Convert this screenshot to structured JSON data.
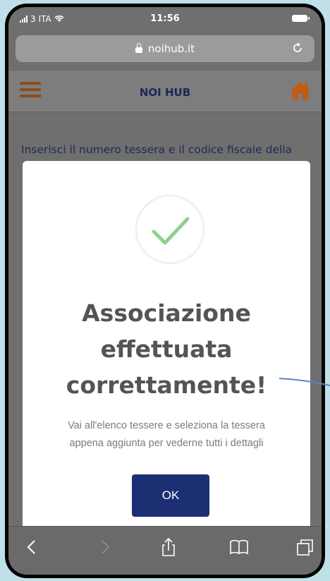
{
  "status_bar": {
    "carrier": "3 ITA",
    "time": "11:56"
  },
  "browser": {
    "url": "noihub.it"
  },
  "header": {
    "title": "NOI HUB"
  },
  "page": {
    "instruction": "Inserisci il numero tessera e il codice fiscale della"
  },
  "modal": {
    "title_line1": "Associazione",
    "title_line2": "effettuata",
    "title_line3": "correttamente!",
    "message_line1": "Vai all'elenco tessere e seleziona la tessera",
    "message_line2": "appena aggiunta per vederne tutti i dettagli",
    "ok_label": "OK"
  },
  "colors": {
    "navy": "#1c2f73",
    "hamburger": "#8c4b1f",
    "home": "#c25a14",
    "check": "#8fd18a"
  }
}
